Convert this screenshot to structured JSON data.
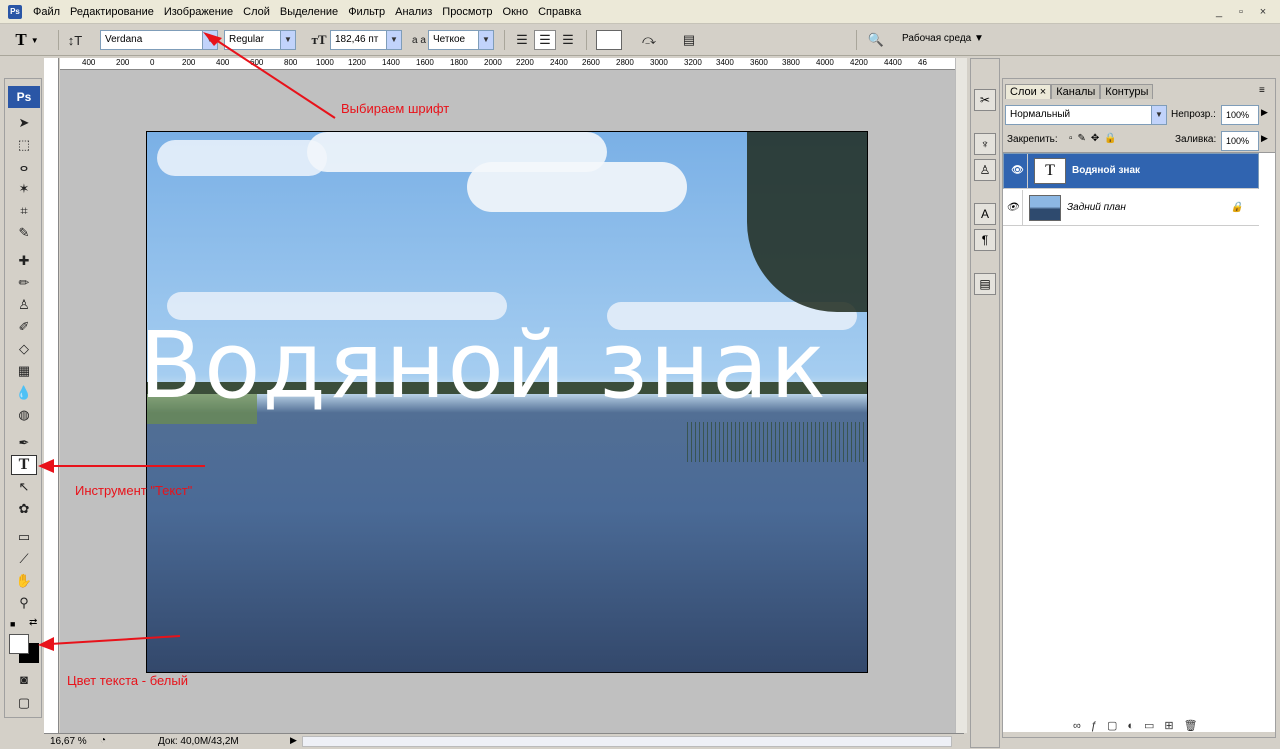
{
  "menubar": {
    "app_icon": "Ps",
    "items": [
      "Файл",
      "Редактирование",
      "Изображение",
      "Слой",
      "Выделение",
      "Фильтр",
      "Анализ",
      "Просмотр",
      "Окно",
      "Справка"
    ],
    "window_buttons": [
      "_",
      "▫",
      "×"
    ]
  },
  "options": {
    "font_family": "Verdana",
    "font_style": "Regular",
    "font_size": "182,46 пт",
    "aa_label": "a a",
    "antialias": "Четкое",
    "workspace": "Рабочая среда"
  },
  "ruler": {
    "ticks": [
      "400",
      "200",
      "0",
      "200",
      "400",
      "600",
      "800",
      "1000",
      "1200",
      "1400",
      "1600",
      "1800",
      "2000",
      "2200",
      "2400",
      "2600",
      "2800",
      "3000",
      "3200",
      "3400",
      "3600",
      "3800",
      "4000",
      "4200",
      "4400",
      "46"
    ]
  },
  "document": {
    "watermark_text": "Водяной знак"
  },
  "annotations": {
    "font": "Выбираем шрифт",
    "tool": "Инструмент \"Текст\"",
    "color": "Цвет текста - белый"
  },
  "status": {
    "zoom": "16,67 %",
    "doc": "Док: 40,0M/43,2M"
  },
  "layers_panel": {
    "tabs": [
      "Слои",
      "Каналы",
      "Контуры"
    ],
    "blend_mode": "Нормальный",
    "opacity_label": "Непрозр.:",
    "opacity_value": "100%",
    "lock_label": "Закрепить:",
    "fill_label": "Заливка:",
    "fill_value": "100%",
    "layers": [
      {
        "name": "Водяной знак",
        "thumb": "T",
        "selected": true
      },
      {
        "name": "Задний план",
        "selected": false
      }
    ]
  },
  "colors": {
    "annotation": "#e8121a",
    "selection": "#3064b0"
  }
}
